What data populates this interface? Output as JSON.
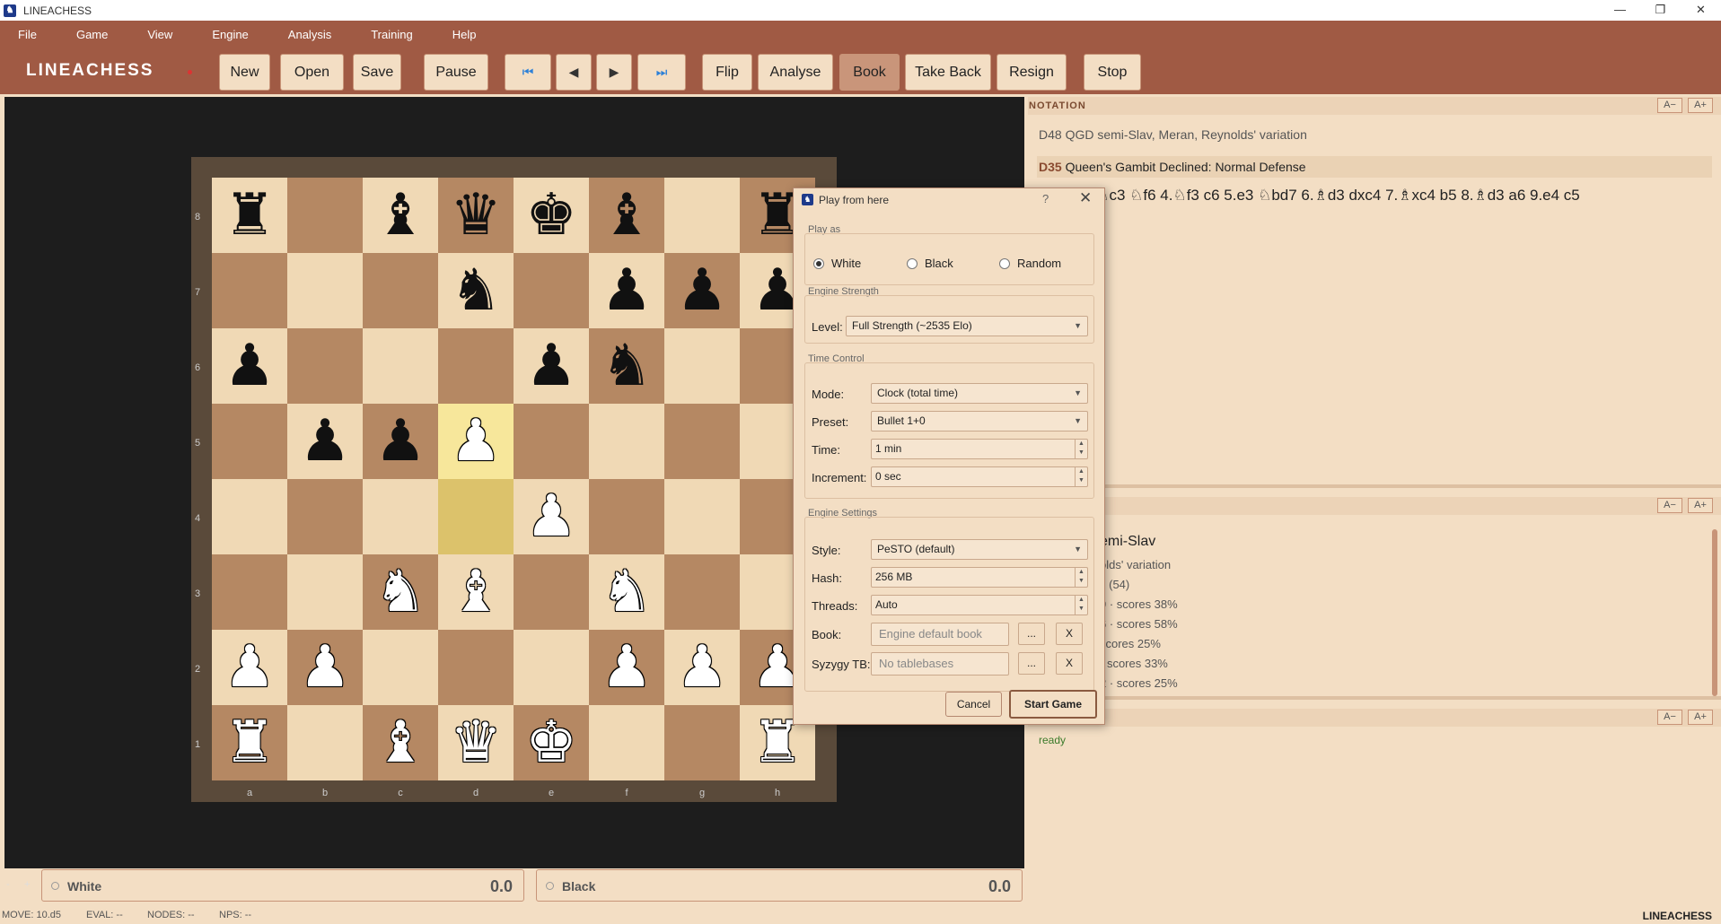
{
  "window": {
    "title": "LINEACHESS",
    "minimize": "—",
    "maximize": "❐",
    "close": "✕"
  },
  "menu": [
    "File",
    "Game",
    "View",
    "Engine",
    "Analysis",
    "Training",
    "Help"
  ],
  "brand": "LINEACHESS",
  "toolbar": {
    "new": "New",
    "open": "Open",
    "save": "Save",
    "pause": "Pause",
    "first": "⏮",
    "prev": "◀",
    "next": "▶",
    "last": "⏭",
    "flip": "Flip",
    "analyse": "Analyse",
    "book": "Book",
    "take_back": "Take Back",
    "resign": "Resign",
    "stop": "Stop"
  },
  "board": {
    "ranks": [
      "8",
      "7",
      "6",
      "5",
      "4",
      "3",
      "2",
      "1"
    ],
    "files": [
      "a",
      "b",
      "c",
      "d",
      "e",
      "f",
      "g",
      "h"
    ],
    "position": [
      [
        "br",
        "",
        "bb",
        "bq",
        "bk",
        "bb",
        "",
        "br"
      ],
      [
        "",
        "",
        "",
        "bn",
        "",
        "bp",
        "bp",
        "bp"
      ],
      [
        "bp",
        "",
        "",
        "",
        "bp",
        "bn",
        "",
        ""
      ],
      [
        "",
        "bp",
        "bp",
        "wp",
        "",
        "",
        "",
        ""
      ],
      [
        "",
        "",
        "",
        "",
        "wp",
        "",
        "",
        ""
      ],
      [
        "",
        "",
        "wn",
        "wb",
        "",
        "wn",
        "",
        ""
      ],
      [
        "wp",
        "wp",
        "",
        "",
        "",
        "wp",
        "wp",
        "wp"
      ],
      [
        "wr",
        "",
        "wb",
        "wq",
        "wk",
        "",
        "",
        "wr"
      ]
    ],
    "highlight_from": "d4",
    "highlight_to": "d5"
  },
  "players": {
    "white": {
      "name": "White",
      "score": "0.0"
    },
    "black": {
      "name": "Black",
      "score": "0.0"
    }
  },
  "mini_controls": [
    "-",
    "+"
  ],
  "status": {
    "move": "MOVE: 10.d5",
    "eval": "EVAL: --",
    "nodes": "NODES: --",
    "nps": "NPS: --",
    "brand": "LINEACHESS"
  },
  "notation": {
    "header": "NOTATION",
    "a_minus": "A−",
    "a_plus": "A+",
    "opening": "D48 QGD semi-Slav, Meran, Reynolds' variation",
    "eco": "D35",
    "eco_name": "Queen's Gambit Declined: Normal Defense",
    "moves": ".c4 e6 3.♘c3 ♘f6 4.♘f3 c6 5.e3 ♘bd7 6.♗d3 dxc4 7.♗xc4 b5 8.♗d3 a6 9.e4 c5"
  },
  "book_panel": {
    "a_minus": "A−",
    "a_plus": "A+",
    "title": "emi-Slav",
    "subtitle": "olds' variation",
    "lines": [
      "s (54)",
      "9 · scores 38%",
      "6 · scores 58%",
      "scores 25%",
      "· scores 33%",
      "2 · scores 25%"
    ]
  },
  "engine_panel": {
    "a_minus": "A−",
    "a_plus": "A+",
    "status": "ready"
  },
  "dialog": {
    "title": "Play from here",
    "help": "?",
    "close": "✕",
    "play_as_label": "Play as",
    "play_as": {
      "white": "White",
      "black": "Black",
      "random": "Random",
      "selected": "White"
    },
    "engine_strength_label": "Engine Strength",
    "level_label": "Level:",
    "level_value": "Full Strength (~2535 Elo)",
    "time_control_label": "Time Control",
    "mode_label": "Mode:",
    "mode_value": "Clock (total time)",
    "preset_label": "Preset:",
    "preset_value": "Bullet 1+0",
    "time_label": "Time:",
    "time_value": "1 min",
    "increment_label": "Increment:",
    "increment_value": "0 sec",
    "engine_settings_label": "Engine Settings",
    "style_label": "Style:",
    "style_value": "PeSTO (default)",
    "hash_label": "Hash:",
    "hash_value": "256 MB",
    "threads_label": "Threads:",
    "threads_value": "Auto",
    "book_label": "Book:",
    "book_placeholder": "Engine default book",
    "syzygy_label": "Syzygy TB:",
    "syzygy_placeholder": "No tablebases",
    "browse": "...",
    "clear": "X",
    "cancel": "Cancel",
    "start": "Start Game"
  },
  "colors": {
    "accent": "#a05a44",
    "panel": "#f3dec4",
    "light_square": "#f0d9b5",
    "dark_square": "#b58863"
  }
}
